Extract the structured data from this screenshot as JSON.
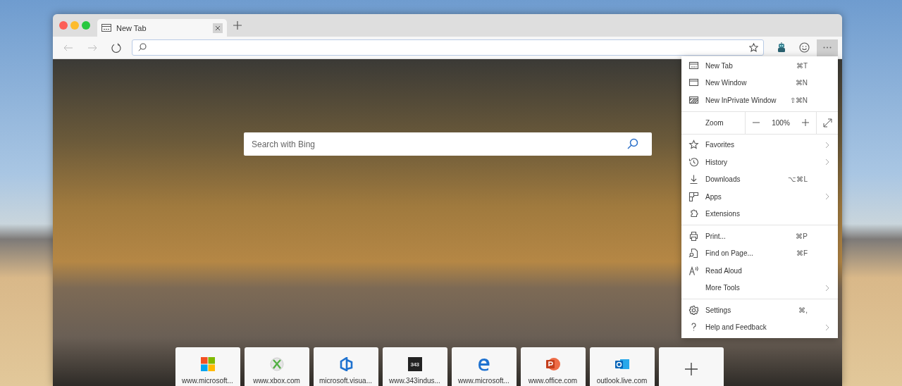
{
  "tabs": [
    {
      "title": "New Tab",
      "selected": true
    }
  ],
  "search": {
    "placeholder": "Search with Bing"
  },
  "menu": {
    "sections": [
      [
        {
          "kind": "item",
          "label": "New Tab",
          "shortcut": "⌘T",
          "submenu": false
        },
        {
          "kind": "item",
          "label": "New Window",
          "shortcut": "⌘N",
          "submenu": false
        },
        {
          "kind": "item",
          "label": "New InPrivate Window",
          "shortcut": "⇧⌘N",
          "submenu": false
        }
      ],
      [
        {
          "kind": "zoom",
          "label": "Zoom",
          "value": "100%"
        }
      ],
      [
        {
          "kind": "item",
          "label": "Favorites",
          "submenu": true
        },
        {
          "kind": "item",
          "label": "History",
          "submenu": true
        },
        {
          "kind": "item",
          "label": "Downloads",
          "shortcut": "⌥⌘L",
          "submenu": false
        },
        {
          "kind": "item",
          "label": "Apps",
          "submenu": true
        },
        {
          "kind": "item",
          "label": "Extensions",
          "submenu": false
        }
      ],
      [
        {
          "kind": "item",
          "label": "Print...",
          "shortcut": "⌘P",
          "submenu": false
        },
        {
          "kind": "item",
          "label": "Find on Page...",
          "shortcut": "⌘F",
          "submenu": false
        },
        {
          "kind": "item",
          "label": "Read Aloud",
          "submenu": false
        },
        {
          "kind": "item",
          "label": "More Tools",
          "submenu": true
        }
      ],
      [
        {
          "kind": "item",
          "label": "Settings",
          "shortcut": "⌘,",
          "submenu": false
        },
        {
          "kind": "item",
          "label": "Help and Feedback",
          "submenu": true
        }
      ]
    ]
  },
  "top_sites": [
    {
      "kind": "site",
      "label": "www.microsoft..."
    },
    {
      "kind": "site",
      "label": "www.xbox.com"
    },
    {
      "kind": "site",
      "label": "microsoft.visua..."
    },
    {
      "kind": "site",
      "label": "www.343indus...",
      "logo_text": "343"
    },
    {
      "kind": "site",
      "label": "www.microsoft..."
    },
    {
      "kind": "site",
      "label": "www.office.com"
    },
    {
      "kind": "site",
      "label": "outlook.live.com"
    },
    {
      "kind": "add"
    }
  ]
}
